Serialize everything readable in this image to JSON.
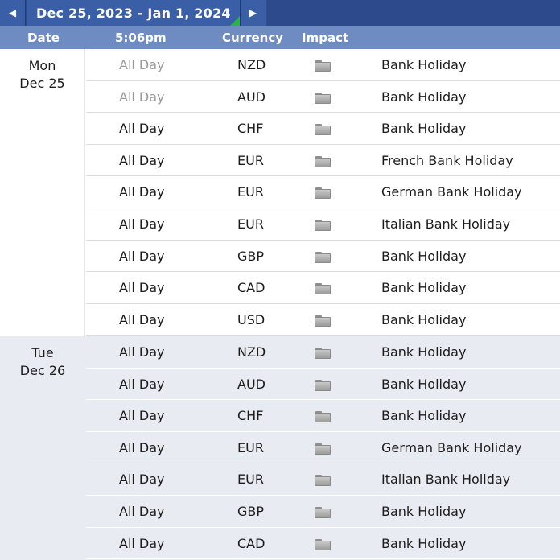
{
  "nav": {
    "prev_icon": "◀",
    "next_icon": "▶",
    "range": "Dec 25, 2023 - Jan 1, 2024"
  },
  "header": {
    "date": "Date",
    "time": "5:06pm",
    "currency": "Currency",
    "impact": "Impact"
  },
  "days": [
    {
      "day": "Mon",
      "date": "Dec 25",
      "rows": [
        {
          "time": "All Day",
          "currency": "NZD",
          "impact": "holiday-icon",
          "event": "Bank Holiday"
        },
        {
          "time": "All Day",
          "currency": "AUD",
          "impact": "holiday-icon",
          "event": "Bank Holiday"
        },
        {
          "time": "All Day",
          "currency": "CHF",
          "impact": "holiday-icon",
          "event": "Bank Holiday"
        },
        {
          "time": "All Day",
          "currency": "EUR",
          "impact": "holiday-icon",
          "event": "French Bank Holiday"
        },
        {
          "time": "All Day",
          "currency": "EUR",
          "impact": "holiday-icon",
          "event": "German Bank Holiday"
        },
        {
          "time": "All Day",
          "currency": "EUR",
          "impact": "holiday-icon",
          "event": "Italian Bank Holiday"
        },
        {
          "time": "All Day",
          "currency": "GBP",
          "impact": "holiday-icon",
          "event": "Bank Holiday"
        },
        {
          "time": "All Day",
          "currency": "CAD",
          "impact": "holiday-icon",
          "event": "Bank Holiday"
        },
        {
          "time": "All Day",
          "currency": "USD",
          "impact": "holiday-icon",
          "event": "Bank Holiday"
        }
      ]
    },
    {
      "day": "Tue",
      "date": "Dec 26",
      "rows": [
        {
          "time": "All Day",
          "currency": "NZD",
          "impact": "holiday-icon",
          "event": "Bank Holiday"
        },
        {
          "time": "All Day",
          "currency": "AUD",
          "impact": "holiday-icon",
          "event": "Bank Holiday"
        },
        {
          "time": "All Day",
          "currency": "CHF",
          "impact": "holiday-icon",
          "event": "Bank Holiday"
        },
        {
          "time": "All Day",
          "currency": "EUR",
          "impact": "holiday-icon",
          "event": "German Bank Holiday"
        },
        {
          "time": "All Day",
          "currency": "EUR",
          "impact": "holiday-icon",
          "event": "Italian Bank Holiday"
        },
        {
          "time": "All Day",
          "currency": "GBP",
          "impact": "holiday-icon",
          "event": "Bank Holiday"
        },
        {
          "time": "All Day",
          "currency": "CAD",
          "impact": "holiday-icon",
          "event": "Bank Holiday"
        }
      ]
    }
  ]
}
